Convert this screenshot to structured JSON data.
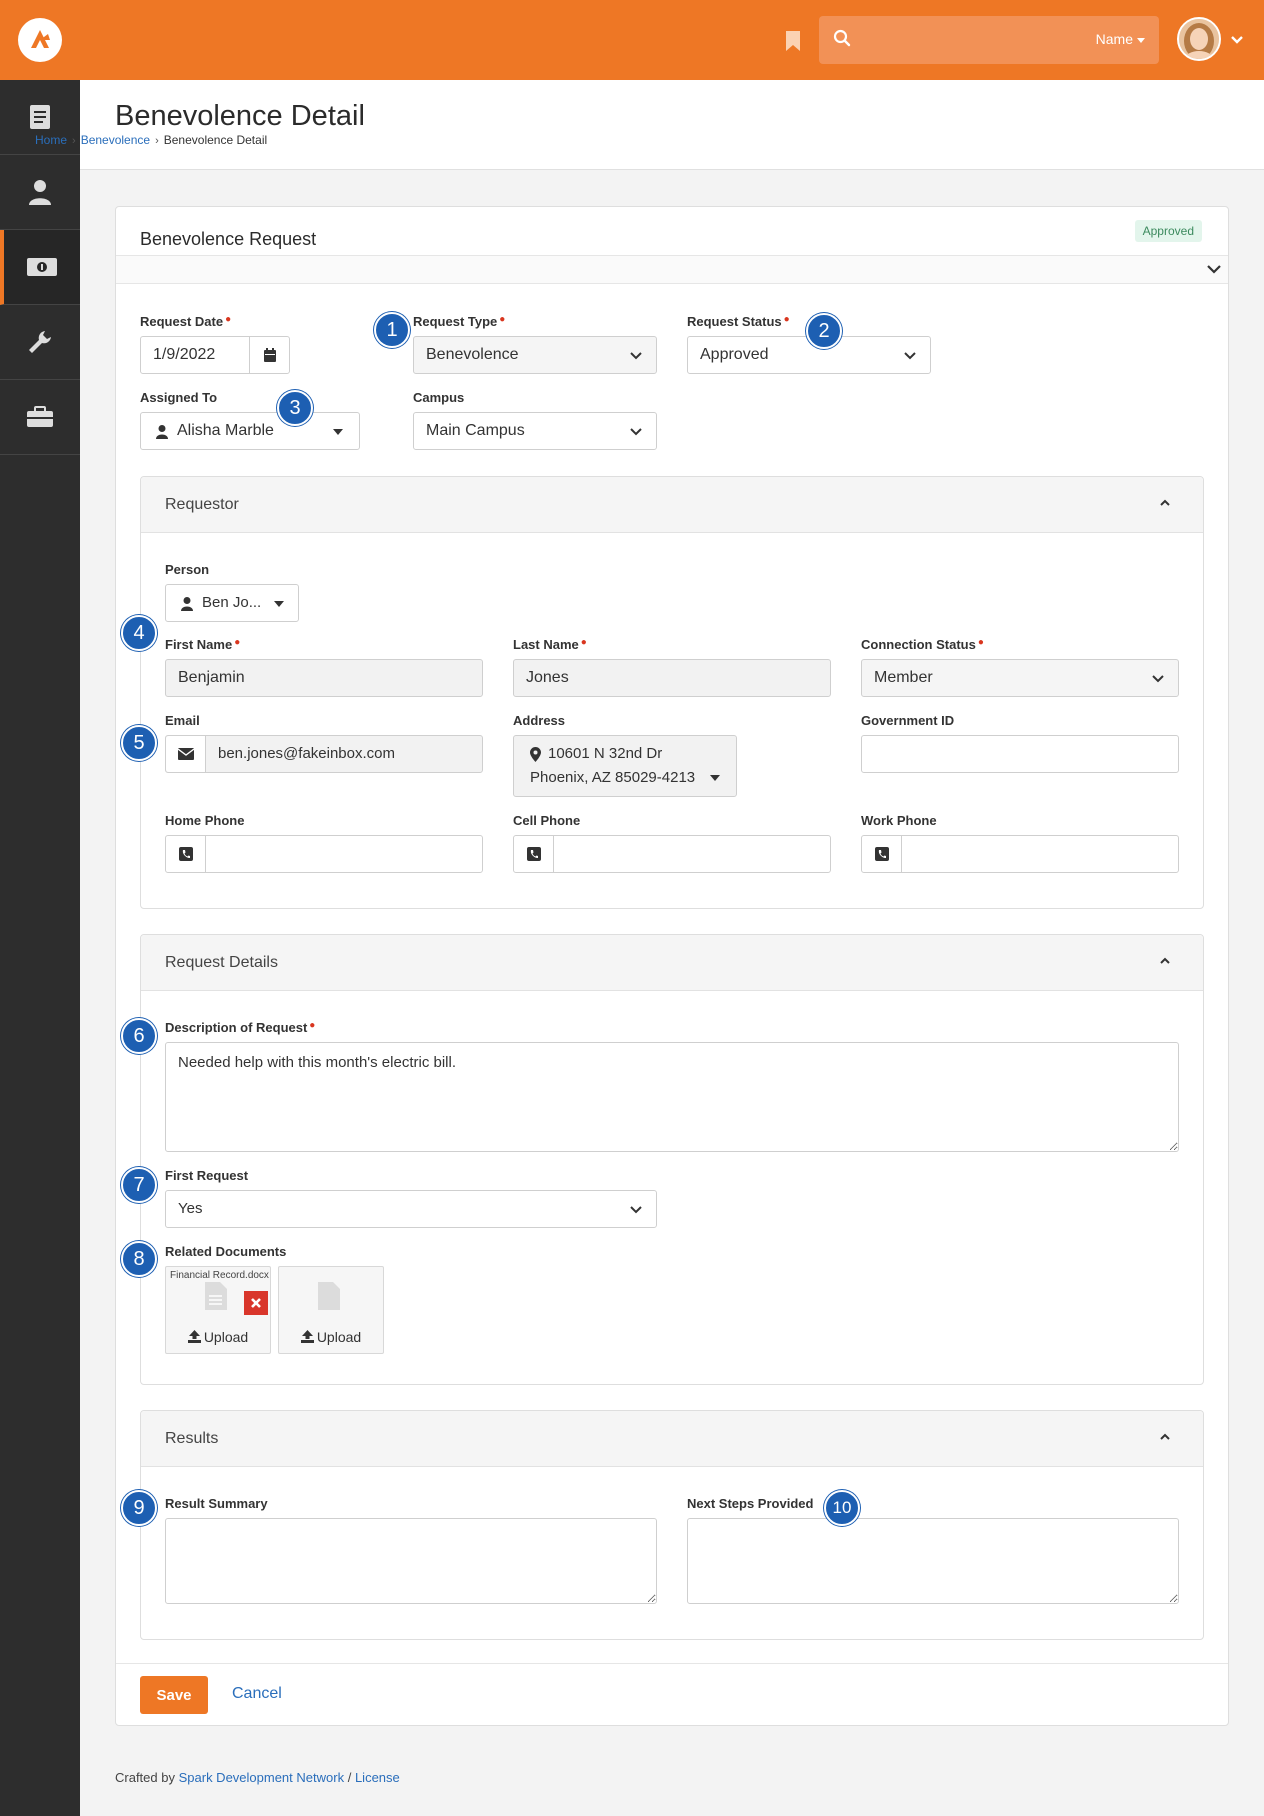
{
  "header": {
    "search_placeholder": "",
    "search_filter": "Name"
  },
  "page": {
    "title": "Benevolence Detail",
    "breadcrumb": [
      "Home",
      "Benevolence",
      "Benevolence Detail"
    ]
  },
  "panel": {
    "title": "Benevolence Request",
    "status_badge": "Approved"
  },
  "request": {
    "date_label": "Request Date",
    "date_value": "1/9/2022",
    "type_label": "Request Type",
    "type_value": "Benevolence",
    "status_label": "Request Status",
    "status_value": "Approved",
    "assigned_label": "Assigned To",
    "assigned_value": "Alisha Marble",
    "campus_label": "Campus",
    "campus_value": "Main Campus"
  },
  "requestor": {
    "title": "Requestor",
    "person_label": "Person",
    "person_value": "Ben Jo...",
    "first_name_label": "First Name",
    "first_name_value": "Benjamin",
    "last_name_label": "Last Name",
    "last_name_value": "Jones",
    "connection_label": "Connection Status",
    "connection_value": "Member",
    "email_label": "Email",
    "email_value": "ben.jones@fakeinbox.com",
    "address_label": "Address",
    "address_line1": "10601 N 32nd Dr",
    "address_line2": "Phoenix, AZ 85029-4213",
    "gov_id_label": "Government ID",
    "gov_id_value": "",
    "home_phone_label": "Home Phone",
    "cell_phone_label": "Cell Phone",
    "work_phone_label": "Work Phone"
  },
  "details": {
    "title": "Request Details",
    "description_label": "Description of Request",
    "description_value": "Needed help with this month's electric bill.",
    "first_request_label": "First Request",
    "first_request_value": "Yes",
    "documents_label": "Related Documents",
    "documents": [
      {
        "name": "Financial Record.docx",
        "upload": "Upload"
      },
      {
        "name": "",
        "upload": "Upload"
      }
    ]
  },
  "results": {
    "title": "Results",
    "summary_label": "Result Summary",
    "next_steps_label": "Next Steps Provided"
  },
  "actions": {
    "save": "Save",
    "cancel": "Cancel"
  },
  "markers": [
    "1",
    "2",
    "3",
    "4",
    "5",
    "6",
    "7",
    "8",
    "9",
    "10"
  ],
  "footer": {
    "crafted_by": "Crafted by",
    "org": "Spark Development Network",
    "sep": "/",
    "license": "License"
  },
  "icons": {
    "sidebar": [
      "document-icon",
      "person-icon",
      "money-icon",
      "wrench-icon",
      "briefcase-icon"
    ]
  },
  "colors": {
    "brand": "#ee7725",
    "link": "#2a6ebb",
    "marker": "#1d5fb2",
    "required": "#d9361f",
    "sidebar": "#2d2d2d"
  }
}
